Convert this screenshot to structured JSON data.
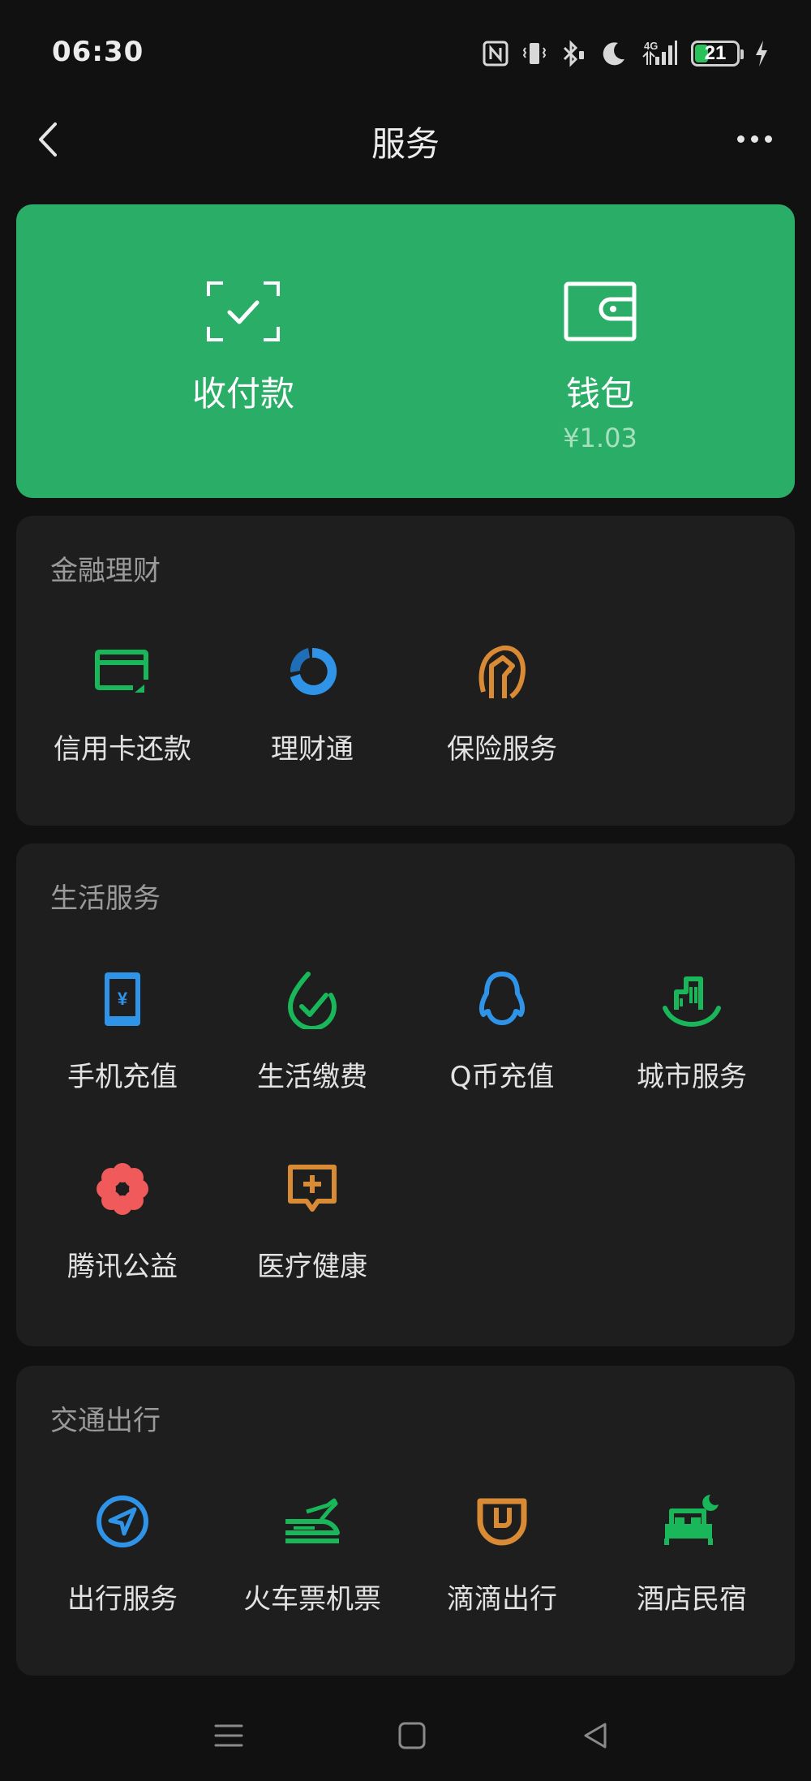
{
  "status_bar": {
    "time": "06:30",
    "network": "4G",
    "battery_level": "21",
    "icons": [
      "nfc-icon",
      "vibrate-icon",
      "bluetooth-icon",
      "moon-icon",
      "signal-icon",
      "battery-icon",
      "charging-icon"
    ]
  },
  "nav": {
    "title": "服务",
    "back_icon": "chevron-left-icon",
    "more_icon": "more-dots-icon"
  },
  "hero": {
    "color": "#2aae67",
    "pay": {
      "label": "收付款",
      "icon": "scan-check-icon"
    },
    "wallet": {
      "label": "钱包",
      "balance": "¥1.03",
      "icon": "wallet-icon"
    }
  },
  "sections": [
    {
      "title": "金融理财",
      "items": [
        {
          "label": "信用卡还款",
          "icon": "credit-card-icon",
          "color": "#19b65a"
        },
        {
          "label": "理财通",
          "icon": "wealth-icon",
          "color": "#2f93e8"
        },
        {
          "label": "保险服务",
          "icon": "insurance-icon",
          "color": "#d88a35"
        }
      ]
    },
    {
      "title": "生活服务",
      "items": [
        {
          "label": "手机充值",
          "icon": "phone-recharge-icon",
          "color": "#2f93e8"
        },
        {
          "label": "生活缴费",
          "icon": "utility-bill-icon",
          "color": "#19b65a"
        },
        {
          "label": "Q币充值",
          "icon": "qq-penguin-icon",
          "color": "#2f93e8"
        },
        {
          "label": "城市服务",
          "icon": "city-icon",
          "color": "#19b65a"
        },
        {
          "label": "腾讯公益",
          "icon": "charity-flower-icon",
          "color": "#f05a5a"
        },
        {
          "label": "医疗健康",
          "icon": "medical-chat-icon",
          "color": "#d88a35"
        }
      ]
    },
    {
      "title": "交通出行",
      "items": [
        {
          "label": "出行服务",
          "icon": "navigation-compass-icon",
          "color": "#2f93e8"
        },
        {
          "label": "火车票机票",
          "icon": "train-plane-icon",
          "color": "#19b65a"
        },
        {
          "label": "滴滴出行",
          "icon": "didi-icon",
          "color": "#d88a35"
        },
        {
          "label": "酒店民宿",
          "icon": "hotel-bed-icon",
          "color": "#19b65a"
        }
      ]
    }
  ],
  "bottom_nav": {
    "icons": [
      "menu-icon",
      "home-square-icon",
      "back-triangle-icon"
    ]
  }
}
